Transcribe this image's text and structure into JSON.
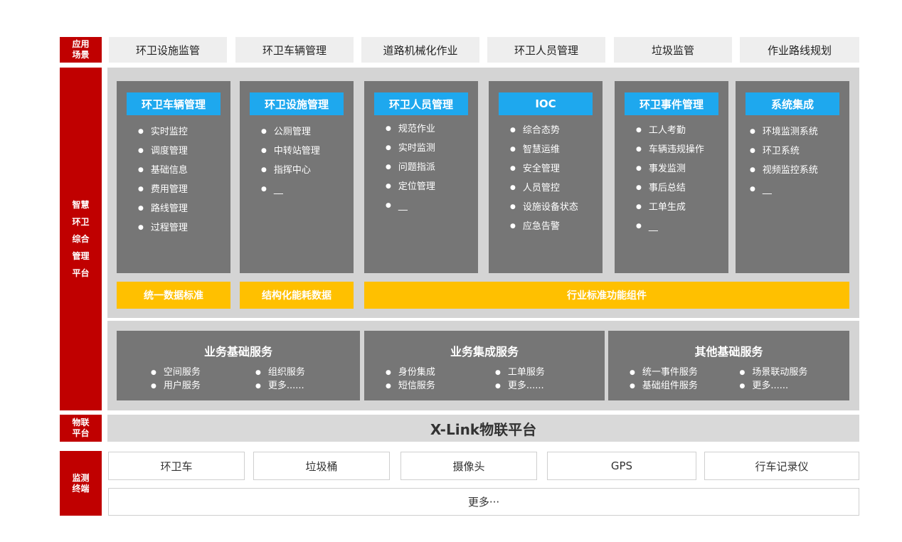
{
  "labels": {
    "scene": [
      "应用",
      "场景"
    ],
    "platform": [
      "智慧",
      "环卫",
      "综合",
      "管理",
      "平台"
    ],
    "iot": [
      "物联",
      "平台"
    ],
    "terminal": [
      "监测",
      "终端"
    ]
  },
  "scenes": [
    "环卫设施监管",
    "环卫车辆管理",
    "道路机械化作业",
    "环卫人员管理",
    "垃圾监管",
    "作业路线规划"
  ],
  "modules": [
    {
      "title": "环卫车辆管理",
      "items": [
        "实时监控",
        "调度管理",
        "基础信息",
        "费用管理",
        "路线管理",
        "过程管理"
      ]
    },
    {
      "title": "环卫设施管理",
      "items": [
        "公厕管理",
        "中转站管理",
        "指挥中心",
        "__"
      ]
    },
    {
      "title": "环卫人员管理",
      "items": [
        "规范作业",
        "实时监测",
        "问题指派",
        "定位管理",
        "__"
      ]
    },
    {
      "title": "IOC",
      "items": [
        "综合态势",
        "智慧运维",
        "安全管理",
        "人员管控",
        "设施设备状态",
        "应急告警"
      ]
    },
    {
      "title": "环卫事件管理",
      "items": [
        "工人考勤",
        "车辆违规操作",
        "事发监测",
        "事后总结",
        "工单生成",
        "__"
      ]
    },
    {
      "title": "系统集成",
      "items": [
        "环境监测系统",
        "环卫系统",
        "视频监控系统",
        "__"
      ]
    }
  ],
  "standards": [
    "统一数据标准",
    "结构化能耗数据",
    "行业标准功能组件"
  ],
  "services": [
    {
      "title": "业务基础服务",
      "items": [
        "空间服务",
        "组织服务",
        "用户服务",
        "更多......"
      ]
    },
    {
      "title": "业务集成服务",
      "items": [
        "身份集成",
        "工单服务",
        "短信服务",
        "更多......"
      ]
    },
    {
      "title": "其他基础服务",
      "items": [
        "统一事件服务",
        "场景联动服务",
        "基础组件服务",
        "更多......"
      ]
    }
  ],
  "iot_platform": "X-Link物联平台",
  "terminals": [
    "环卫车",
    "垃圾桶",
    "摄像头",
    "GPS",
    "行车记录仪"
  ],
  "terminals_more": "更多···",
  "colors": {
    "red": "#c00000",
    "blue": "#1ea8ee",
    "yellow": "#ffc000",
    "card_gray": "#767676",
    "panel_gray": "#d4d4d4"
  }
}
